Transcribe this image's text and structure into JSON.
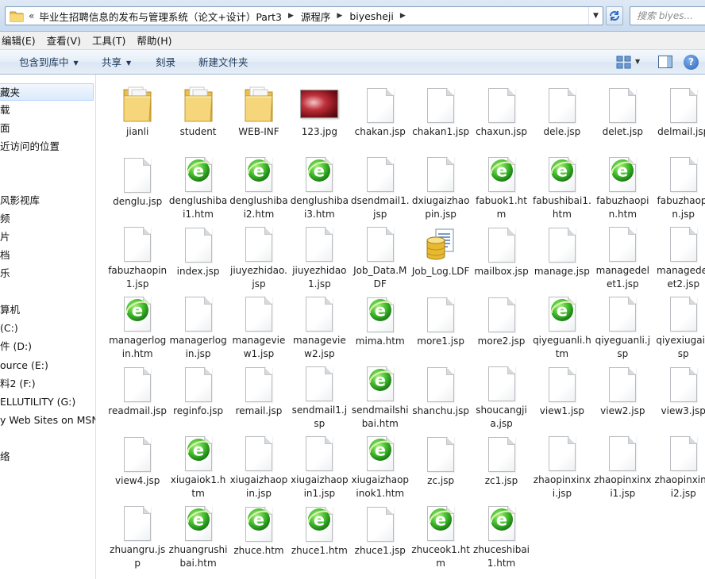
{
  "address_bar": {
    "prefix": "«",
    "crumbs": [
      "毕业生招聘信息的发布与管理系统（论文+设计）Part3",
      "源程序",
      "biyesheji"
    ],
    "search_placeholder": "搜索 biyes..."
  },
  "menu": [
    "编辑(E)",
    "查看(V)",
    "工具(T)",
    "帮助(H)"
  ],
  "commands": {
    "include_library": "包含到库中",
    "share": "共享",
    "burn": "刻录",
    "new_folder": "新建文件夹"
  },
  "sidebar": [
    "藏夹",
    "载",
    "面",
    "近访问的位置",
    "风影视库",
    "频",
    "片",
    "档",
    "乐",
    "算机",
    "(C:)",
    "件 (D:)",
    "ource (E:)",
    "料2 (F:)",
    "ELLUTILITY (G:)",
    "y Web Sites on MSN",
    "络"
  ],
  "files": [
    {
      "name": "jianli",
      "icon": "folder-icon"
    },
    {
      "name": "student",
      "icon": "folder-icon"
    },
    {
      "name": "WEB-INF",
      "icon": "folder-icon"
    },
    {
      "name": "123.jpg",
      "icon": "image-thumbnail"
    },
    {
      "name": "chakan.jsp",
      "icon": "document-icon"
    },
    {
      "name": "chakan1.jsp",
      "icon": "document-icon"
    },
    {
      "name": "chaxun.jsp",
      "icon": "document-icon"
    },
    {
      "name": "dele.jsp",
      "icon": "document-icon"
    },
    {
      "name": "delet.jsp",
      "icon": "document-icon"
    },
    {
      "name": "delmail.jsp",
      "icon": "document-icon"
    },
    {
      "name": "denglu.jsp",
      "icon": "document-icon"
    },
    {
      "name": "denglushibai1.htm",
      "icon": "ie-document-icon"
    },
    {
      "name": "denglushibai2.htm",
      "icon": "ie-document-icon"
    },
    {
      "name": "denglushibai3.htm",
      "icon": "ie-document-icon"
    },
    {
      "name": "dsendmail1.jsp",
      "icon": "document-icon"
    },
    {
      "name": "dxiugaizhaopin.jsp",
      "icon": "document-icon"
    },
    {
      "name": "fabuok1.htm",
      "icon": "ie-document-icon"
    },
    {
      "name": "fabushibai1.htm",
      "icon": "ie-document-icon"
    },
    {
      "name": "fabuzhaopin.htm",
      "icon": "ie-document-icon"
    },
    {
      "name": "fabuzhaopin.jsp",
      "icon": "document-icon"
    },
    {
      "name": "fabuzhaopin1.jsp",
      "icon": "document-icon"
    },
    {
      "name": "index.jsp",
      "icon": "document-icon"
    },
    {
      "name": "jiuyezhidao.jsp",
      "icon": "document-icon"
    },
    {
      "name": "jiuyezhidao1.jsp",
      "icon": "document-icon"
    },
    {
      "name": "Job_Data.MDF",
      "icon": "document-icon"
    },
    {
      "name": "Job_Log.LDF",
      "icon": "database-log-icon"
    },
    {
      "name": "mailbox.jsp",
      "icon": "document-icon"
    },
    {
      "name": "manage.jsp",
      "icon": "document-icon"
    },
    {
      "name": "managedelet1.jsp",
      "icon": "document-icon"
    },
    {
      "name": "managedelet2.jsp",
      "icon": "document-icon"
    },
    {
      "name": "managerlogin.htm",
      "icon": "ie-document-icon"
    },
    {
      "name": "managerlogin.jsp",
      "icon": "document-icon"
    },
    {
      "name": "manageview1.jsp",
      "icon": "document-icon"
    },
    {
      "name": "manageview2.jsp",
      "icon": "document-icon"
    },
    {
      "name": "mima.htm",
      "icon": "ie-document-icon"
    },
    {
      "name": "more1.jsp",
      "icon": "document-icon"
    },
    {
      "name": "more2.jsp",
      "icon": "document-icon"
    },
    {
      "name": "qiyeguanli.htm",
      "icon": "ie-document-icon"
    },
    {
      "name": "qiyeguanli.jsp",
      "icon": "document-icon"
    },
    {
      "name": "qiyexiugai.jsp",
      "icon": "document-icon"
    },
    {
      "name": "readmail.jsp",
      "icon": "document-icon"
    },
    {
      "name": "reginfo.jsp",
      "icon": "document-icon"
    },
    {
      "name": "remail.jsp",
      "icon": "document-icon"
    },
    {
      "name": "sendmail1.jsp",
      "icon": "document-icon"
    },
    {
      "name": "sendmailshibai.htm",
      "icon": "ie-document-icon"
    },
    {
      "name": "shanchu.jsp",
      "icon": "document-icon"
    },
    {
      "name": "shoucangjia.jsp",
      "icon": "document-icon"
    },
    {
      "name": "view1.jsp",
      "icon": "document-icon"
    },
    {
      "name": "view2.jsp",
      "icon": "document-icon"
    },
    {
      "name": "view3.jsp",
      "icon": "document-icon"
    },
    {
      "name": "view4.jsp",
      "icon": "document-icon"
    },
    {
      "name": "xiugaiok1.htm",
      "icon": "ie-document-icon"
    },
    {
      "name": "xiugaizhaopin.jsp",
      "icon": "document-icon"
    },
    {
      "name": "xiugaizhaopin1.jsp",
      "icon": "document-icon"
    },
    {
      "name": "xiugaizhaopinok1.htm",
      "icon": "ie-document-icon"
    },
    {
      "name": "zc.jsp",
      "icon": "document-icon"
    },
    {
      "name": "zc1.jsp",
      "icon": "document-icon"
    },
    {
      "name": "zhaopinxinxi.jsp",
      "icon": "document-icon"
    },
    {
      "name": "zhaopinxinxi1.jsp",
      "icon": "document-icon"
    },
    {
      "name": "zhaopinxinxi2.jsp",
      "icon": "document-icon"
    },
    {
      "name": "zhuangru.jsp",
      "icon": "document-icon"
    },
    {
      "name": "zhuangrushibai.htm",
      "icon": "ie-document-icon"
    },
    {
      "name": "zhuce.htm",
      "icon": "ie-document-icon"
    },
    {
      "name": "zhuce1.htm",
      "icon": "ie-document-icon"
    },
    {
      "name": "zhuce1.jsp",
      "icon": "document-icon"
    },
    {
      "name": "zhuceok1.htm",
      "icon": "ie-document-icon"
    },
    {
      "name": "zhuceshibai1.htm",
      "icon": "ie-document-icon"
    }
  ]
}
